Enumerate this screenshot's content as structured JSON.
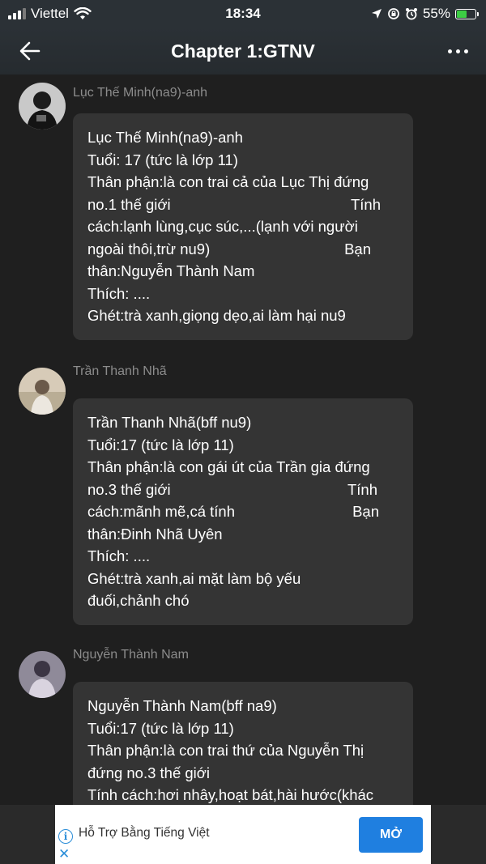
{
  "status_bar": {
    "carrier": "Viettel",
    "time": "18:34",
    "battery": "55%",
    "battery_level": 0.55,
    "icons": [
      "signal-icon",
      "wifi-icon",
      "location-icon",
      "rotation-lock-icon",
      "alarm-icon",
      "battery-charging-icon"
    ]
  },
  "header": {
    "title": "Chapter 1:GTNV",
    "back_icon": "arrow-left-icon",
    "more_icon": "more-horizontal-icon"
  },
  "messages": [
    {
      "sender": "Lục Thế Minh(na9)-anh",
      "lines": [
        "Lục Thế Minh(na9)-anh",
        "Tuổi: 17 (tức là lớp 11)",
        "Thân phận:là con trai cả của Lục Thị đứng",
        [
          "no.1 thế giới",
          "Tính"
        ],
        "cách:lạnh lùng,cục súc,...(lạnh với người",
        [
          "ngoài thôi,trừ nu9)",
          "Bạn"
        ],
        "thân:Nguyễn Thành Nam",
        "Thích: ....",
        "Ghét:trà xanh,giọng dẹo,ai làm hại nu9"
      ]
    },
    {
      "sender": "Trần Thanh Nhã",
      "lines": [
        "Trần Thanh Nhã(bff nu9)",
        "Tuổi:17 (tức là lớp 11)",
        "Thân phận:là con gái út của Trần gia đứng",
        [
          "no.3 thế giới",
          "Tính"
        ],
        [
          "cách:mãnh mẽ,cá tính",
          "Bạn"
        ],
        "thân:Đinh Nhã Uyên",
        "Thích: ....",
        "Ghét:trà xanh,ai mặt làm bộ yếu",
        "đuối,chảnh chó"
      ]
    },
    {
      "sender": "Nguyễn Thành Nam",
      "lines": [
        "Nguyễn Thành Nam(bff na9)",
        "Tuổi:17 (tức là lớp 11)",
        "Thân phận:là con trai thứ của Nguyễn Thị",
        "đứng no.3 thế giới",
        "Tính cách:hơi nhây,hoạt bát,hài hước(khác"
      ]
    }
  ],
  "ad": {
    "text": "Hỗ Trợ Bằng Tiếng Việt",
    "button_label": "MỞ",
    "info_icon": "info-icon",
    "close_icon": "close-icon",
    "accent_color": "#1f7fe0"
  }
}
